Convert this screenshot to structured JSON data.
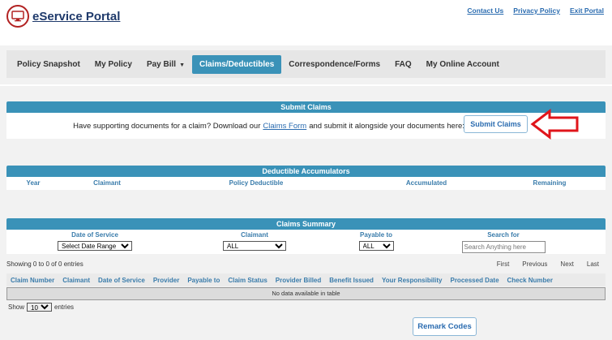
{
  "header": {
    "title": "eService Portal",
    "links": [
      "Contact Us",
      "Privacy Policy",
      "Exit Portal"
    ]
  },
  "nav": {
    "items": [
      {
        "label": "Policy Snapshot"
      },
      {
        "label": "My Policy"
      },
      {
        "label": "Pay Bill"
      },
      {
        "label": "Claims/Deductibles"
      },
      {
        "label": "Correspondence/Forms"
      },
      {
        "label": "FAQ"
      },
      {
        "label": "My Online Account"
      }
    ],
    "active": "Claims/Deductibles"
  },
  "submit_claims": {
    "title": "Submit Claims",
    "text_before": "Have supporting documents for a claim? Download our",
    "link_text": "Claims Form",
    "text_after": "and submit it alongside your documents here:",
    "button_label": "Submit Claims"
  },
  "deductible": {
    "title": "Deductible Accumulators",
    "columns": [
      "Year",
      "Claimant",
      "Policy Deductible",
      "Accumulated",
      "Remaining"
    ]
  },
  "claims_summary": {
    "title": "Claims Summary",
    "filters": {
      "date_of_service": {
        "label": "Date of Service",
        "value": "Select Date Range"
      },
      "claimant": {
        "label": "Claimant",
        "value": "ALL"
      },
      "payable_to": {
        "label": "Payable to",
        "value": "ALL"
      },
      "search_for": {
        "label": "Search for",
        "placeholder": "Search Anything here"
      }
    },
    "showing_text": "Showing 0 to 0 of 0 entries",
    "pager": [
      "First",
      "Previous",
      "Next",
      "Last"
    ],
    "columns": [
      "Claim Number",
      "Claimant",
      "Date of Service",
      "Provider",
      "Payable to",
      "Claim Status",
      "Provider Billed",
      "Benefit Issued",
      "Your Responsibility",
      "Processed Date",
      "Check Number"
    ],
    "empty_text": "No data available in table",
    "show_label": "Show",
    "show_value": "10",
    "entries_label": "entries",
    "remark_button": "Remark Codes"
  },
  "colors": {
    "accent": "#3a92b8",
    "link": "#2b6cb0",
    "logo": "#b22222",
    "arrow": "#e0151b"
  }
}
